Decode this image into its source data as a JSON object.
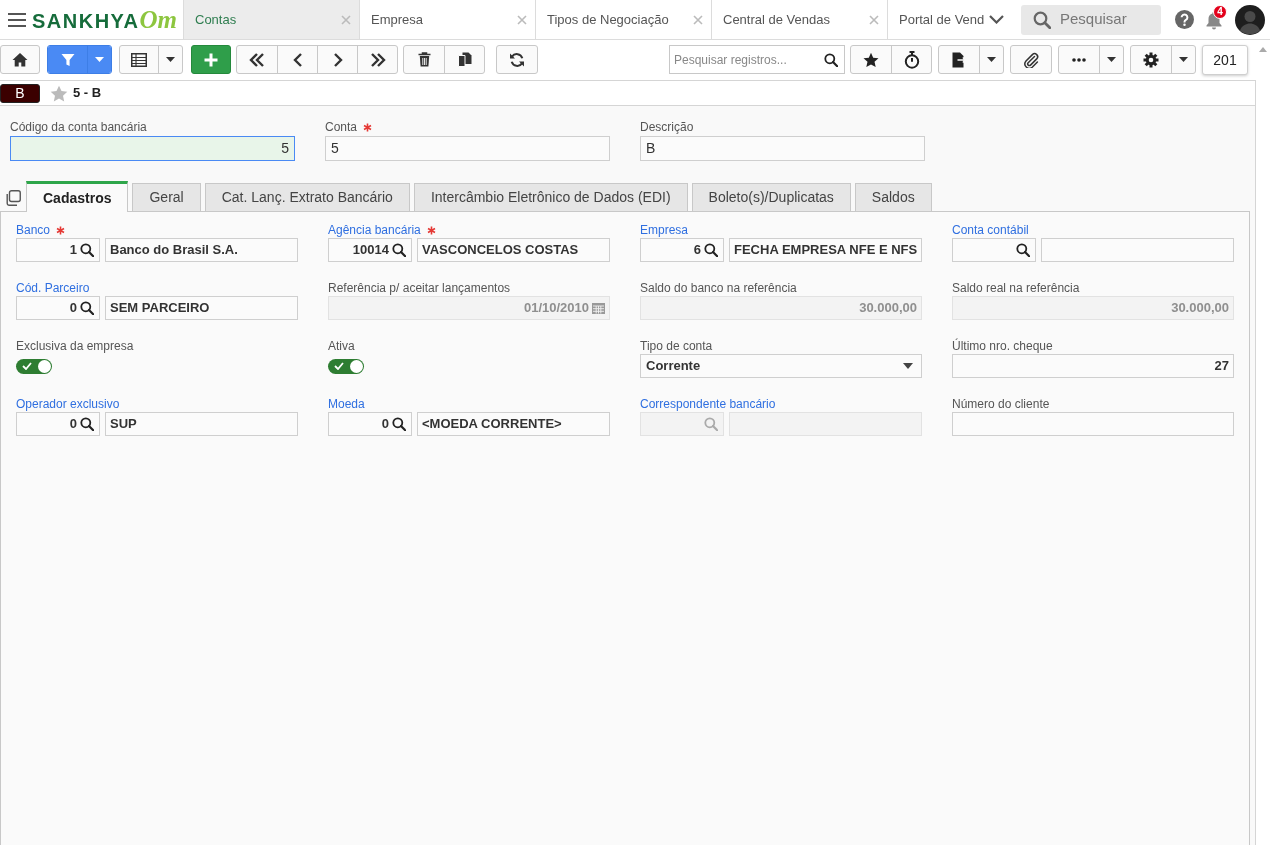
{
  "app_bar": {
    "logo": {
      "wordmark": "SANKHYA",
      "suffix": "Om"
    },
    "tabs": [
      {
        "label": "Contas",
        "selected": true,
        "closable": true
      },
      {
        "label": "Empresa",
        "selected": false,
        "closable": true
      },
      {
        "label": "Tipos de Negociação",
        "selected": false,
        "closable": true
      },
      {
        "label": "Central de Vendas",
        "selected": false,
        "closable": true
      },
      {
        "label": "Portal de Vend",
        "selected": false,
        "closable": false
      }
    ],
    "search": {
      "placeholder": "Pesquisar"
    },
    "notification_count": "4"
  },
  "toolbar": {
    "filter_active": true,
    "search": {
      "placeholder": "Pesquisar registros..."
    },
    "record_count": "201"
  },
  "record": {
    "badge": "B",
    "favorite": false,
    "title": "5 - B"
  },
  "header_fields": [
    {
      "kind": "number",
      "label": "Código da conta bancária",
      "required": false,
      "focused": true,
      "value": "5"
    },
    {
      "kind": "text",
      "label": "Conta",
      "required": true,
      "focused": false,
      "value": "5"
    },
    {
      "kind": "text",
      "label": "Descrição",
      "required": false,
      "focused": false,
      "value": "B"
    }
  ],
  "tabs": [
    {
      "label": "Cadastros",
      "selected": true
    },
    {
      "label": "Geral",
      "selected": false
    },
    {
      "label": "Cat. Lanç. Extrato Bancário",
      "selected": false
    },
    {
      "label": "Intercâmbio Eletrônico de Dados (EDI)",
      "selected": false
    },
    {
      "label": "Boleto(s)/Duplicatas",
      "selected": false
    },
    {
      "label": "Saldos",
      "selected": false
    }
  ],
  "form_fields": [
    {
      "kind": "lookup",
      "label": "Banco",
      "link": true,
      "required": true,
      "disabled": false,
      "code": "1",
      "description": "Banco do Brasil S.A."
    },
    {
      "kind": "lookup",
      "label": "Agência bancária",
      "link": true,
      "required": true,
      "disabled": false,
      "code": "10014",
      "description": "VASCONCELOS COSTAS"
    },
    {
      "kind": "lookup",
      "label": "Empresa",
      "link": true,
      "required": false,
      "disabled": false,
      "code": "6",
      "description": "FECHA EMPRESA NFE E NFS"
    },
    {
      "kind": "lookup",
      "label": "Conta contábil",
      "link": true,
      "required": false,
      "disabled": false
    },
    {
      "kind": "lookup",
      "label": "Cód. Parceiro",
      "link": true,
      "required": false,
      "disabled": false,
      "code": "0",
      "description": "SEM PARCEIRO"
    },
    {
      "kind": "date",
      "label": "Referência p/ aceitar lançamentos",
      "link": false,
      "required": false,
      "disabled": true,
      "value": "01/10/2010"
    },
    {
      "kind": "number",
      "label": "Saldo do banco na referência",
      "link": false,
      "required": false,
      "disabled": true,
      "value": "30.000,00"
    },
    {
      "kind": "number",
      "label": "Saldo real na referência",
      "link": false,
      "required": false,
      "disabled": true,
      "value": "30.000,00"
    },
    {
      "kind": "toggle",
      "label": "Exclusiva da empresa",
      "link": false,
      "required": false,
      "disabled": false,
      "on": true
    },
    {
      "kind": "toggle",
      "label": "Ativa",
      "link": false,
      "required": false,
      "disabled": false,
      "on": true
    },
    {
      "kind": "select",
      "label": "Tipo de conta",
      "link": false,
      "required": false,
      "disabled": false,
      "value": "Corrente"
    },
    {
      "kind": "number",
      "label": "Último nro. cheque",
      "link": false,
      "required": false,
      "disabled": false,
      "value": "27"
    },
    {
      "kind": "lookup",
      "label": "Operador exclusivo",
      "link": true,
      "required": false,
      "disabled": false,
      "code": "0",
      "description": "SUP"
    },
    {
      "kind": "lookup",
      "label": "Moeda",
      "link": true,
      "required": false,
      "disabled": false,
      "code": "0",
      "description": "<MOEDA CORRENTE>"
    },
    {
      "kind": "lookup",
      "label": "Correspondente bancário",
      "link": true,
      "required": false,
      "disabled": true
    },
    {
      "kind": "text",
      "label": "Número do cliente",
      "link": false,
      "required": false,
      "disabled": false
    }
  ]
}
